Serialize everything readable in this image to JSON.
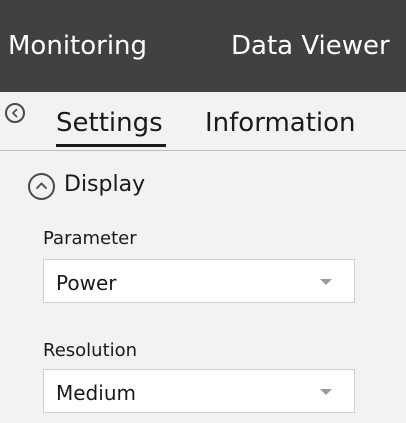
{
  "nav": {
    "items": [
      {
        "label": "Monitoring"
      },
      {
        "label": "Data Viewer"
      }
    ]
  },
  "tabs": {
    "back_icon": "chevron-left-icon",
    "items": [
      {
        "label": "Settings",
        "active": true
      },
      {
        "label": "Information",
        "active": false
      }
    ]
  },
  "section": {
    "title": "Display",
    "icon": "chevron-up-icon",
    "fields": [
      {
        "label": "Parameter",
        "value": "Power"
      },
      {
        "label": "Resolution",
        "value": "Medium"
      }
    ]
  },
  "colors": {
    "topbar_bg": "#414141",
    "panel_bg": "#f2f2f2",
    "text": "#1a1a1a"
  }
}
